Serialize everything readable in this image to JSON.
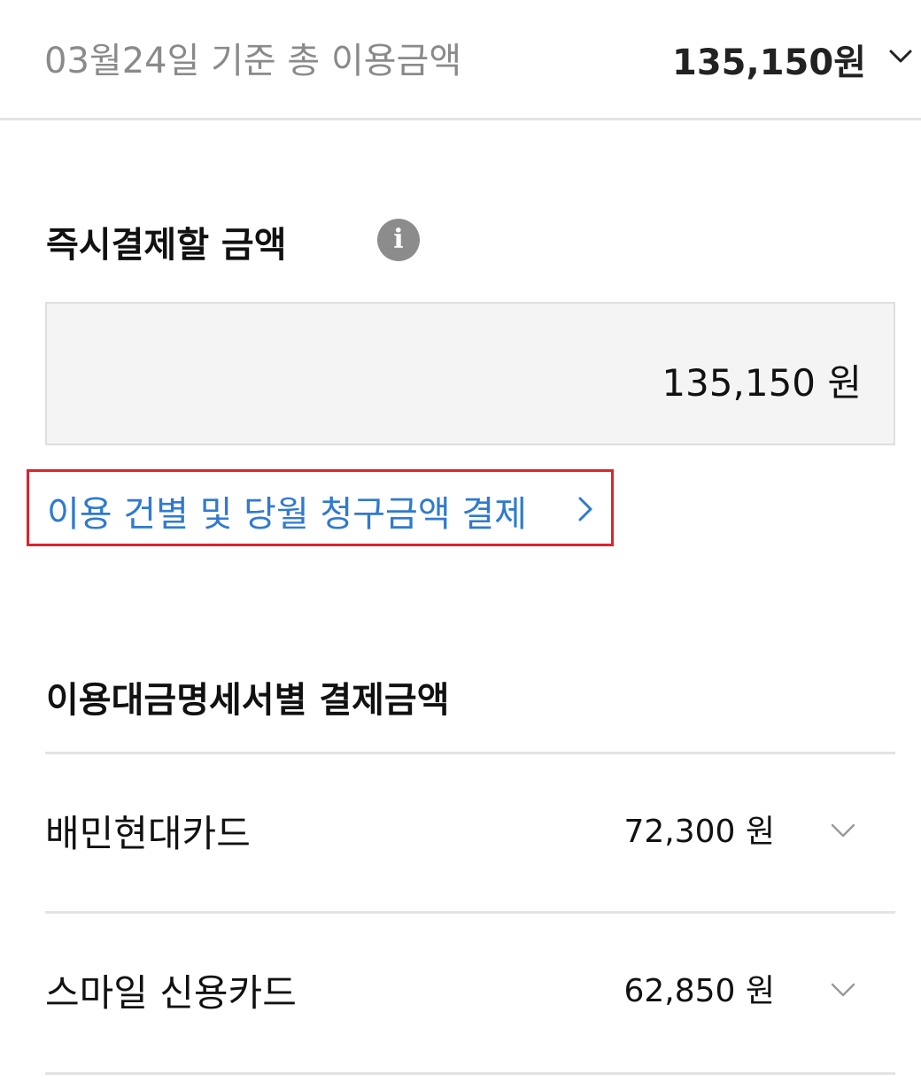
{
  "summary": {
    "date_label": "03월24일 기준 총 이용금액",
    "total": "135,150원"
  },
  "instant_payment": {
    "title": "즉시결제할 금액",
    "info_icon_glyph": "i",
    "amount": "135,150 원",
    "link_label": "이용 건별 및 당월 청구금액 결제"
  },
  "statements": {
    "title": "이용대금명세서별 결제금액",
    "cards": [
      {
        "name": "배민현대카드",
        "amount": "72,300 원"
      },
      {
        "name": "스마일 신용카드",
        "amount": "62,850 원"
      }
    ]
  },
  "colors": {
    "link": "#2f7ad0",
    "highlight_border": "#e1222d",
    "muted_text": "#8a8a8a"
  },
  "icons": [
    "chevron-down-icon",
    "info-icon",
    "chevron-right-icon"
  ]
}
